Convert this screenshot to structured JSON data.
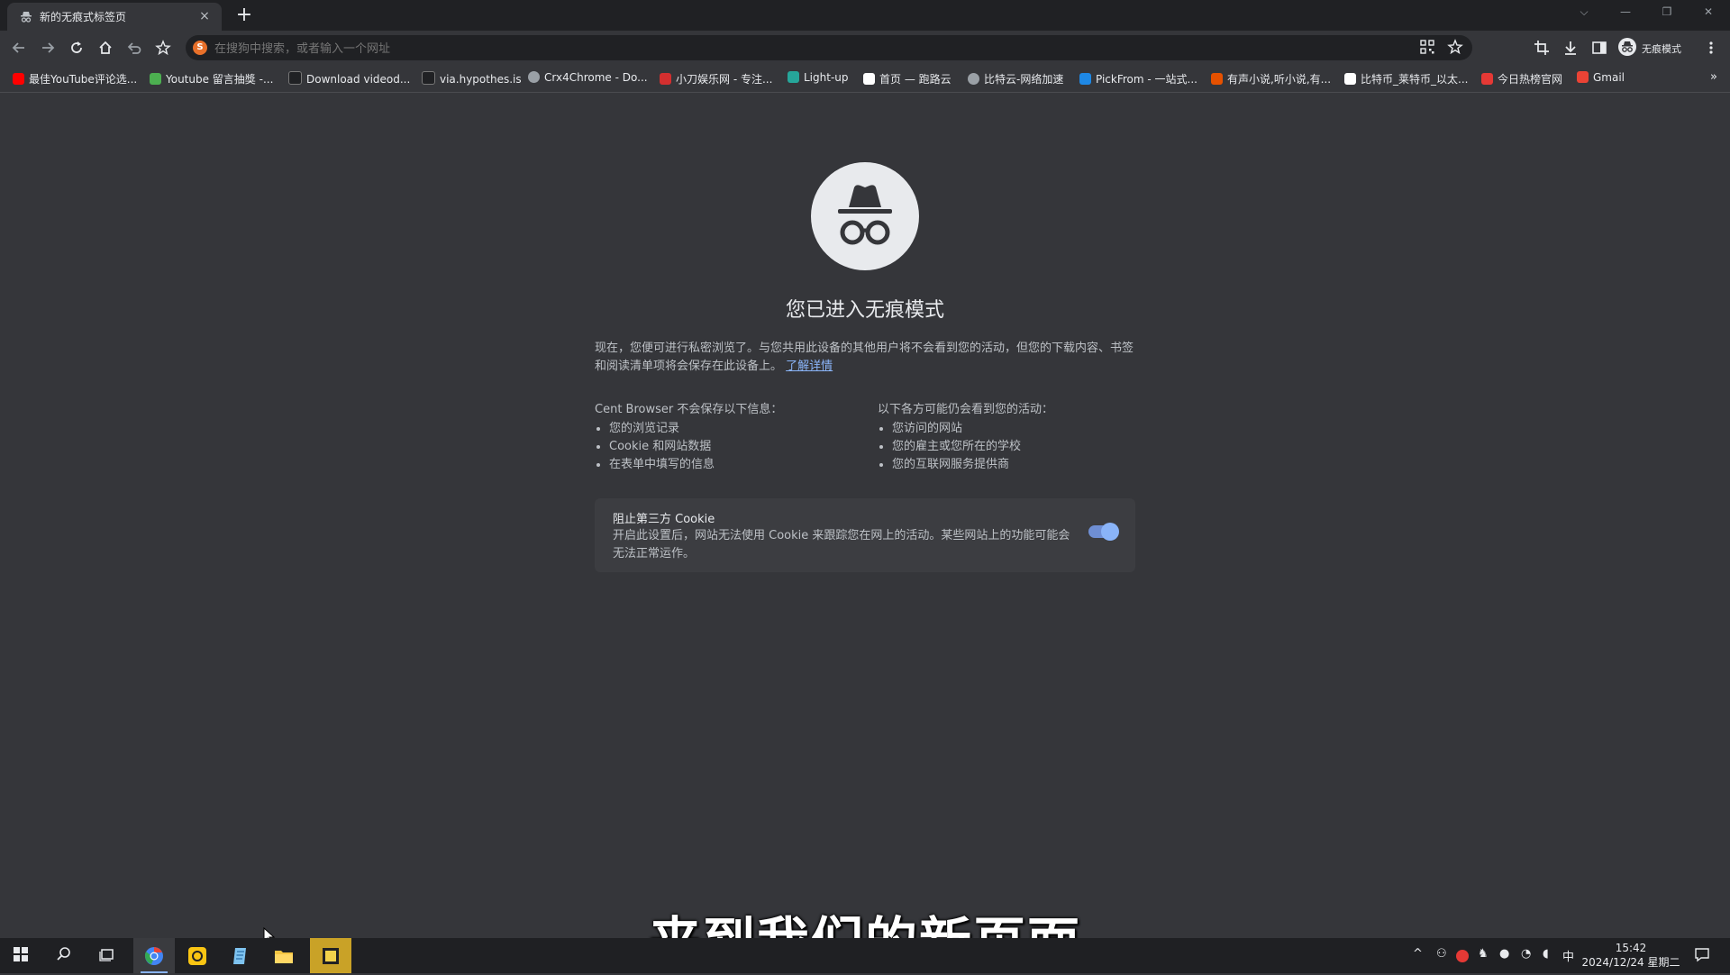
{
  "window": {
    "tab": {
      "title": "新的无痕式标签页",
      "close_glyph": "×"
    },
    "new_tab_glyph": "+",
    "controls": {
      "tabsearch": "⌵",
      "minimize": "—",
      "restore": "❐",
      "close": "✕"
    }
  },
  "toolbar": {
    "omnibox_placeholder": "在搜狗中搜索，或者输入一个网址",
    "search_engine_badge": "S",
    "profile_label": "无痕模式"
  },
  "bookmarks": [
    {
      "label": "最佳YouTube评论选...",
      "color": "#ff0000"
    },
    {
      "label": "Youtube 留言抽獎 -...",
      "color": "#4caf50"
    },
    {
      "label": "Download videod...",
      "color": "#202124"
    },
    {
      "label": "via.hypothes.is",
      "color": "#202124"
    },
    {
      "label": "Crx4Chrome - Do...",
      "color": "#9aa0a6"
    },
    {
      "label": "小刀娱乐网 - 专注...",
      "color": "#d32f2f"
    },
    {
      "label": "Light-up",
      "color": "#26a69a"
    },
    {
      "label": "首页 — 跑路云",
      "color": "#ffffff"
    },
    {
      "label": "比特云-网络加速",
      "color": "#9aa0a6"
    },
    {
      "label": "PickFrom - 一站式...",
      "color": "#1e88e5"
    },
    {
      "label": "有声小说,听小说,有...",
      "color": "#e65100"
    },
    {
      "label": "比特币_莱特币_以太...",
      "color": "#ffffff"
    },
    {
      "label": "今日热榜官网",
      "color": "#e53935"
    },
    {
      "label": "Gmail",
      "color": "#ea4335"
    }
  ],
  "bookmarks_more": "»",
  "page": {
    "heading": "您已进入无痕模式",
    "intro": "现在，您便可进行私密浏览了。与您共用此设备的其他用户将不会看到您的活动，但您的下载内容、书签和阅读清单项将会保存在此设备上。",
    "learn_more": "了解详情",
    "left_col": {
      "heading": "Cent Browser 不会保存以下信息：",
      "items": [
        "您的浏览记录",
        "Cookie 和网站数据",
        "在表单中填写的信息"
      ]
    },
    "right_col": {
      "heading": "以下各方可能仍会看到您的活动：",
      "items": [
        "您访问的网站",
        "您的雇主或您所在的学校",
        "您的互联网服务提供商"
      ]
    },
    "cookie_card": {
      "title": "阻止第三方 Cookie",
      "description": "开启此设置后，网站无法使用 Cookie 来跟踪您在网上的活动。某些网站上的功能可能会无法正常运作。",
      "toggle_on": true
    }
  },
  "subtitle": "来到我们的新页面",
  "taskbar": {
    "ime": "中",
    "time": "15:42",
    "date": "2024/12/24 星期二"
  },
  "colors": {
    "accent": "#8ab4f8",
    "background": "#35363a",
    "tabstrip": "#202124"
  }
}
